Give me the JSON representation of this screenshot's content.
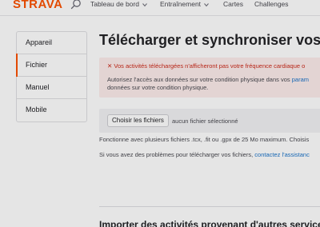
{
  "brand": {
    "name": "STRAVA",
    "color": "#fc5200"
  },
  "topnav": {
    "items": [
      {
        "label": "Tableau de bord",
        "dropdown": true
      },
      {
        "label": "Entraînement",
        "dropdown": true
      },
      {
        "label": "Cartes",
        "dropdown": false
      },
      {
        "label": "Challenges",
        "dropdown": false
      }
    ],
    "search_icon": "search-icon"
  },
  "sidebar": {
    "items": [
      {
        "label": "Appareil",
        "active": false
      },
      {
        "label": "Fichier",
        "active": true
      },
      {
        "label": "Manuel",
        "active": false
      },
      {
        "label": "Mobile",
        "active": false
      }
    ]
  },
  "main": {
    "title": "Télécharger et synchroniser vos",
    "alert": {
      "title": "Vos activités téléchargées n'afficheront pas votre fréquence cardiaque o",
      "body_line1": "Autorisez l'accès aux données sur votre condition physique dans vos",
      "body_link": "param",
      "body_line2": "données sur votre condition physique."
    },
    "file": {
      "button_label": "Choisir les fichiers",
      "status": "aucun fichier sélectionné"
    },
    "info_text": "Fonctionne avec plusieurs fichiers .tcx, .fit ou .gpx de 25 Mo maximum. Choisis",
    "help_text": "Si vous avez des problèmes pour télécharger vos fichiers,",
    "help_link": "contactez l'assistanc",
    "section_title": "Importer des activités provenant d'autres service"
  },
  "colors": {
    "accent": "#fc5200",
    "link": "#1a73c9",
    "error": "#cc2a1a",
    "alert_bg": "#fdeceb"
  }
}
